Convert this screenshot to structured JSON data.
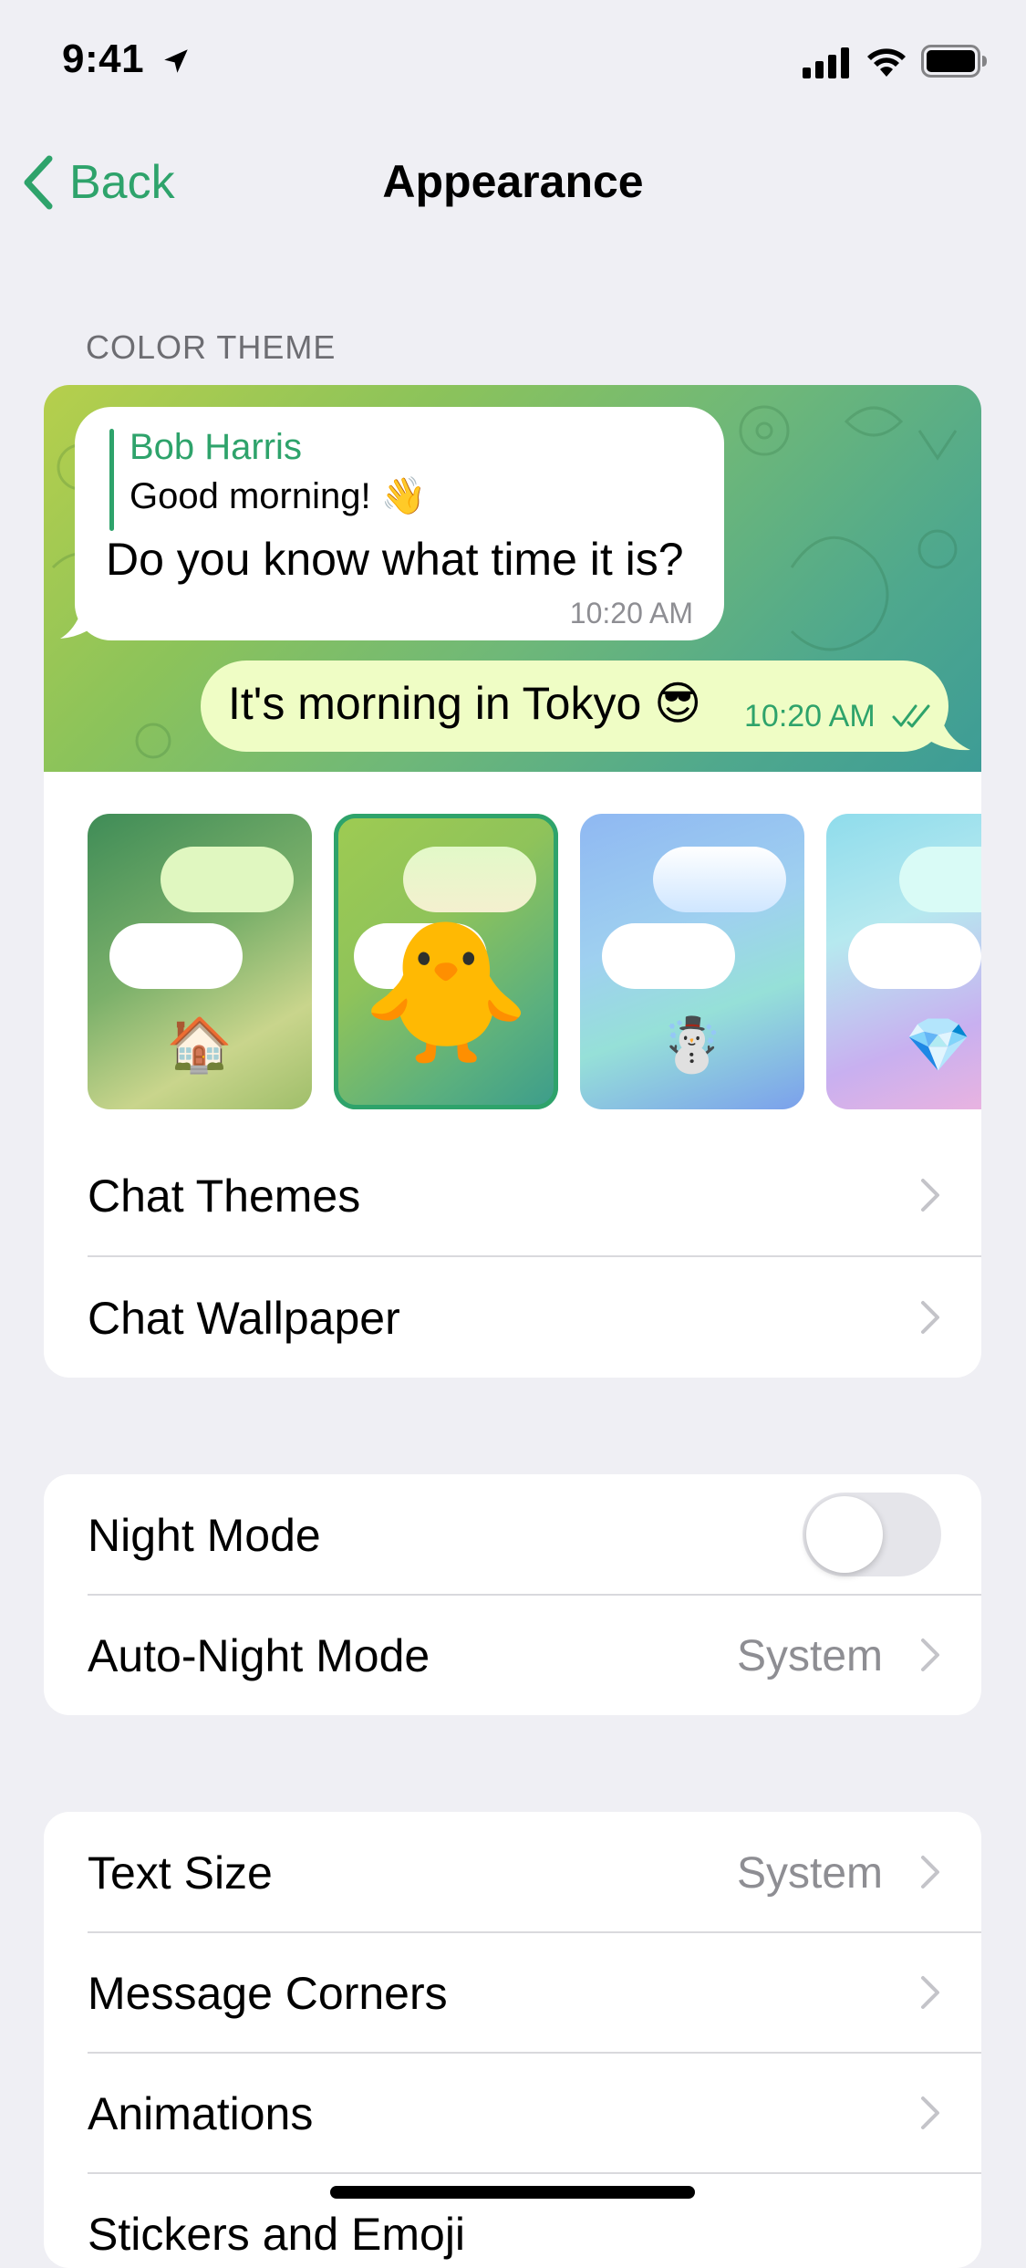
{
  "status_bar": {
    "time": "9:41"
  },
  "nav": {
    "back_label": "Back",
    "title": "Appearance"
  },
  "color_theme": {
    "header": "COLOR THEME",
    "preview": {
      "reply_name": "Bob Harris",
      "reply_text": "Good morning! 👋",
      "incoming_text": "Do you know what time it is?",
      "incoming_time": "10:20 AM",
      "outgoing_text": "It's morning in Tokyo 😎",
      "outgoing_time": "10:20 AM"
    },
    "themes": [
      {
        "emoji": "🏠",
        "selected": false
      },
      {
        "emoji": "🐥",
        "selected": true
      },
      {
        "emoji": "☃️",
        "selected": false
      },
      {
        "emoji": "💎",
        "selected": false
      }
    ],
    "rows": [
      {
        "label": "Chat Themes"
      },
      {
        "label": "Chat Wallpaper"
      }
    ]
  },
  "night": {
    "night_mode_label": "Night Mode",
    "night_mode_on": false,
    "auto_night_label": "Auto-Night Mode",
    "auto_night_value": "System"
  },
  "display": {
    "rows": [
      {
        "label": "Text Size",
        "value": "System"
      },
      {
        "label": "Message Corners"
      },
      {
        "label": "Animations"
      },
      {
        "label": "Stickers and Emoji"
      }
    ]
  },
  "colors": {
    "accent": "#2ea36b",
    "secondary_text": "#8e8e93",
    "background": "#efeff4"
  }
}
